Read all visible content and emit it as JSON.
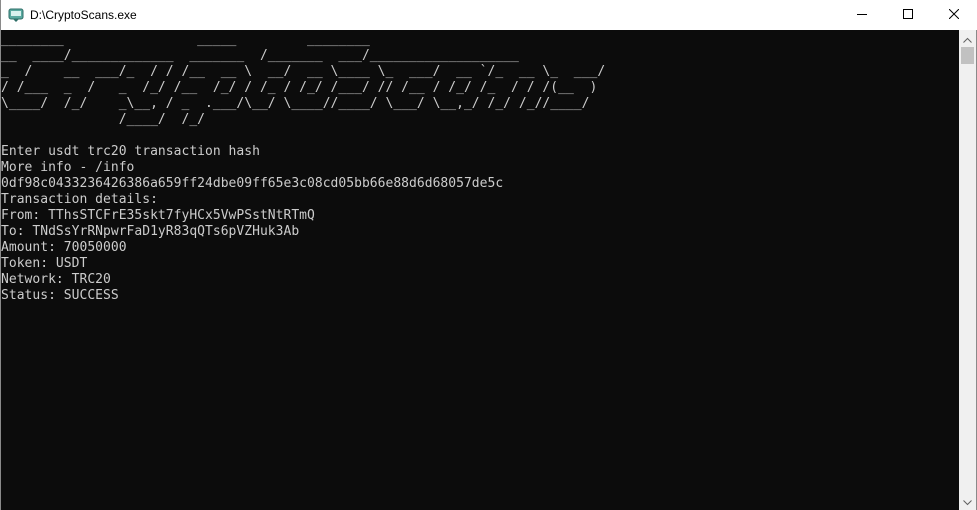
{
  "window": {
    "title": "D:\\CryptoScans.exe",
    "app_icon": "console-app-icon"
  },
  "controls": {
    "minimize_icon": "minimize-icon",
    "maximize_icon": "maximize-icon",
    "close_icon": "close-icon"
  },
  "console": {
    "banner": "________                 _____         ________\n__  ____/_____________  _______  /_______  ___/___________________\n_  /    __  ___/_  / / /__  __ \\  __/  __ \\____ \\_  ___/  __ `/_  __ \\_  ___/\n/ /___  _  /   _  /_/ /__  /_/ / /_ / /_/ /___/ // /__ / /_/ /_  / / /(__  )\n\\____/  /_/    _\\__, / _  .___/\\__/ \\____//____/ \\___/ \\__,_/ /_/ /_//____/\n               /____/  /_/",
    "lines": [
      "Enter usdt trc20 transaction hash",
      "More info - /info",
      "0df98c0433236426386a659ff24dbe09ff65e3c08cd05bb66e88d6d68057de5c",
      "Transaction details:",
      "From: TThsSTCFrE35skt7fyHCx5VwPSstNtRTmQ",
      "To: TNdSsYrRNpwrFaD1yR83qQTs6pVZHuk3Ab",
      "Amount: 70050000",
      "Token: USDT",
      "Network: TRC20",
      "Status: SUCCESS"
    ]
  },
  "colors": {
    "console_bg": "#0c0c0c",
    "console_text": "#cccccc",
    "titlebar_bg": "#ffffff"
  }
}
